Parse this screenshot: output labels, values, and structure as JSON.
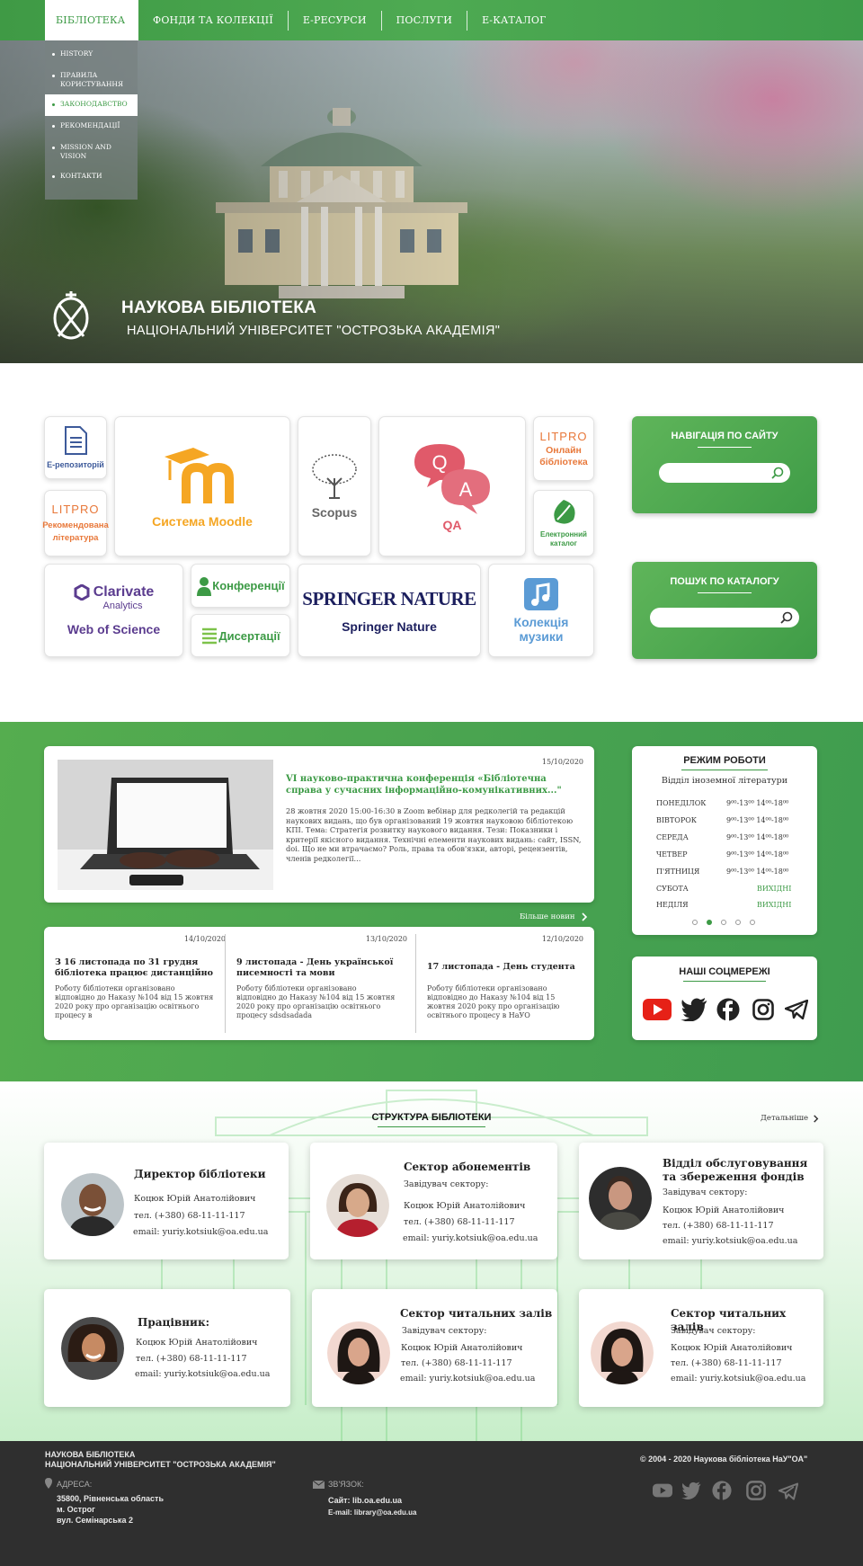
{
  "nav": {
    "items": [
      "БІБЛІОТЕКА",
      "ФОНДИ ТА КОЛЕКЦІЇ",
      "Е-РЕСУРСИ",
      "ПОСЛУГИ",
      "Е-КАТАЛОГ"
    ],
    "dropdown": [
      "HISTORY",
      "ПРАВИЛА КОРИСТУВАННЯ",
      "ЗАКОНОДАВСТВО",
      "РЕКОМЕНДАЦІЇ",
      "MISSION AND VISION",
      "КОНТАКТИ"
    ],
    "dropdown_selected": "ЗАКОНОДАВСТВО"
  },
  "brand": {
    "title": "НАУКОВА БІБЛІОТЕКА",
    "subtitle": "НАЦІОНАЛЬНИЙ УНІВЕРСИТЕТ \"ОСТРОЗЬКА АКАДЕМІЯ\""
  },
  "tiles": {
    "repo": "Е-репозиторій",
    "moodle": "Система Moodle",
    "scopus": "Scopus",
    "qa": "QA",
    "litpro_logo": "LITPRO",
    "litpro_online": "Онлайн бібліотека",
    "litpro_rec": "Рекомендована література",
    "ecat": "Електронний каталог",
    "clarivate": "Clarivate",
    "analytics": "Analytics",
    "wos": "Web of Science",
    "conf": "Конференції",
    "diss": "Дисертації",
    "springer_logo": "SPRINGER NATURE",
    "springer": "Springer Nature",
    "music": "Колекція музики"
  },
  "side": {
    "nav_title": "НАВІГАЦІЯ ПО САЙТУ",
    "catalog_title": "ПОШУК ПО КАТАЛОГУ",
    "nav_search_placeholder": "",
    "catalog_search_placeholder": ""
  },
  "news": {
    "featured": {
      "date": "15/10/2020",
      "title": "VI науково-практична конференція «Бібліотечна справа у сучасних інформаційно-комунікативних...\"",
      "body": "28 жовтня 2020 15:00-16:30 в Zoom вебінар для редколегій та редакцій наукових видань, що був організований 19 жовтня науковою бібліотекою КПІ. Тема: Стратегія розвитку наукового видання. Тези: Показники і критерії якісного видання. Технічні елементи наукових видань: сайт, ISSN, doi. Що не ми втрачаємо? Роль, права та обов'язки, авторі, рецензентів, членів редколегії..."
    },
    "more": "Більше новин",
    "items": [
      {
        "date": "14/10/2020",
        "title": "З 16 листопада по 31 грудня бібліотека працює дистанційно",
        "body": "Роботу бібліотеки організовано відповідно до Наказу №104 від 15 жовтня 2020 року про організацію освітнього процесу в"
      },
      {
        "date": "13/10/2020",
        "title": "9 листопада - День української писемності та мови",
        "body": "Роботу бібліотеки організовано відповідно до Наказу №104 від 15 жовтня 2020 року про організацію освітнього процесу sdsdsadada"
      },
      {
        "date": "12/10/2020",
        "title": "17 листопада - День студента",
        "body": "Роботу бібліотеки організовано відповідно до Наказу №104 від 15 жовтня 2020 року про організацію освітнього процесу в НаУО"
      }
    ]
  },
  "schedule": {
    "title": "РЕЖИМ РОБОТИ",
    "dept": "Відділ іноземної літератури",
    "rows": [
      {
        "day": "ПОНЕДІЛОК",
        "hours": "9⁰⁰-13⁰⁰  14⁰⁰-18⁰⁰"
      },
      {
        "day": "ВІВТОРОК",
        "hours": "9⁰⁰-13⁰⁰  14⁰⁰-18⁰⁰"
      },
      {
        "day": "СЕРЕДА",
        "hours": "9⁰⁰-13⁰⁰  14⁰⁰-18⁰⁰"
      },
      {
        "day": "ЧЕТВЕР",
        "hours": "9⁰⁰-13⁰⁰  14⁰⁰-18⁰⁰"
      },
      {
        "day": "П'ЯТНИЦЯ",
        "hours": "9⁰⁰-13⁰⁰  14⁰⁰-18⁰⁰"
      },
      {
        "day": "СУБОТА",
        "hours": "ВИХІДНІ"
      },
      {
        "day": "НЕДІЛЯ",
        "hours": "ВИХІДНІ"
      }
    ]
  },
  "social": {
    "title": "НАШІ СОЦМЕРЕЖІ"
  },
  "structure": {
    "title": "СТРУКТУРА БІБЛІОТЕКИ",
    "details": "Детальніше",
    "cards": [
      {
        "title": "Директор бібліотеки",
        "role": "",
        "name": "Коцюк Юрій Анатолійович",
        "phone": "тел. (+380) 68-11-11-117",
        "email": "email: yuriy.kotsiuk@oa.edu.ua"
      },
      {
        "title": "Сектор абонементів",
        "role": "Завідувач сектору:",
        "name": "Коцюк Юрій Анатолійович",
        "phone": "тел. (+380) 68-11-11-117",
        "email": "email: yuriy.kotsiuk@oa.edu.ua"
      },
      {
        "title": "Відділ обслуговування та збереження фондів",
        "role": "Завідувач сектору:",
        "name": "Коцюк Юрій Анатолійович",
        "phone": "тел. (+380) 68-11-11-117",
        "email": "email: yuriy.kotsiuk@oa.edu.ua"
      },
      {
        "title": "Працівник:",
        "role": "",
        "name": "Коцюк Юрій Анатолійович",
        "phone": "тел. (+380) 68-11-11-117",
        "email": "email: yuriy.kotsiuk@oa.edu.ua"
      },
      {
        "title": "Сектор читальних залів",
        "role": "Завідувач сектору:",
        "name": "Коцюк Юрій Анатолійович",
        "phone": "тел. (+380) 68-11-11-117",
        "email": "email: yuriy.kotsiuk@oa.edu.ua"
      },
      {
        "title": "Сектор читальних залів",
        "role": "Завідувач сектору:",
        "name": "Коцюк Юрій Анатолійович",
        "phone": "тел. (+380) 68-11-11-117",
        "email": "email: yuriy.kotsiuk@oa.edu.ua"
      }
    ]
  },
  "footer": {
    "org1": "НАУКОВА БІБЛІОТЕКА",
    "org2": "НАЦІОНАЛЬНИЙ УНІВЕРСИТЕТ \"ОСТРОЗЬКА АКАДЕМІЯ\"",
    "address_label": "АДРЕСА:",
    "address1": "35800, Рівненська область",
    "address2": "м. Острог",
    "address3": "вул. Семінарська 2",
    "contact_label": "ЗВ'ЯЗОК:",
    "site": "Сайт: lib.oa.edu.ua",
    "email": "E-mail: library@oa.edu.ua",
    "copyright": "© 2004 - 2020 Наукова бібліотека НаУ\"ОА\""
  },
  "colors": {
    "accent": "#3c9a45",
    "footer": "#2f2f2f",
    "moodle": "#f5a623",
    "qa": "#e05a6a",
    "litpro": "#e8783a",
    "clarivate": "#5b3c8f",
    "springer": "#1c1f5e"
  }
}
